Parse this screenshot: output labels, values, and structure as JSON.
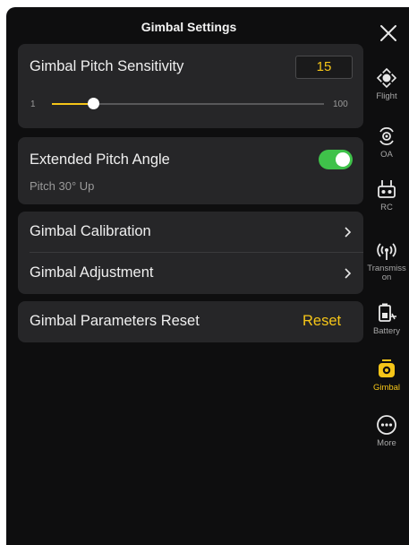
{
  "header": {
    "title": "Gimbal Settings"
  },
  "pitch_sensitivity": {
    "label": "Gimbal Pitch Sensitivity",
    "value": "15",
    "min_label": "1",
    "max_label": "100",
    "level_fraction": 0.15
  },
  "extended_pitch": {
    "label": "Extended Pitch Angle",
    "sublabel": "Pitch 30° Up",
    "enabled": true
  },
  "menu": [
    {
      "label": "Gimbal Calibration"
    },
    {
      "label": "Gimbal Adjustment"
    }
  ],
  "reset_row": {
    "label": "Gimbal Parameters Reset",
    "action": "Reset"
  },
  "sidebar": {
    "items": [
      {
        "label": "Flight",
        "icon": "drone-icon"
      },
      {
        "label": "OA",
        "icon": "obstacle-avoidance-icon"
      },
      {
        "label": "RC",
        "icon": "remote-controller-icon"
      },
      {
        "label": "Transmiss",
        "label2": "on",
        "icon": "transmission-icon"
      },
      {
        "label": "Battery",
        "icon": "battery-icon"
      },
      {
        "label": "Gimbal",
        "icon": "gimbal-icon",
        "active": true
      },
      {
        "label": "More",
        "icon": "more-icon"
      }
    ]
  },
  "colors": {
    "accent": "#f5c518",
    "toggle_on": "#3fc24a",
    "card_bg": "#262628",
    "panel_bg": "#0e0e0f"
  }
}
